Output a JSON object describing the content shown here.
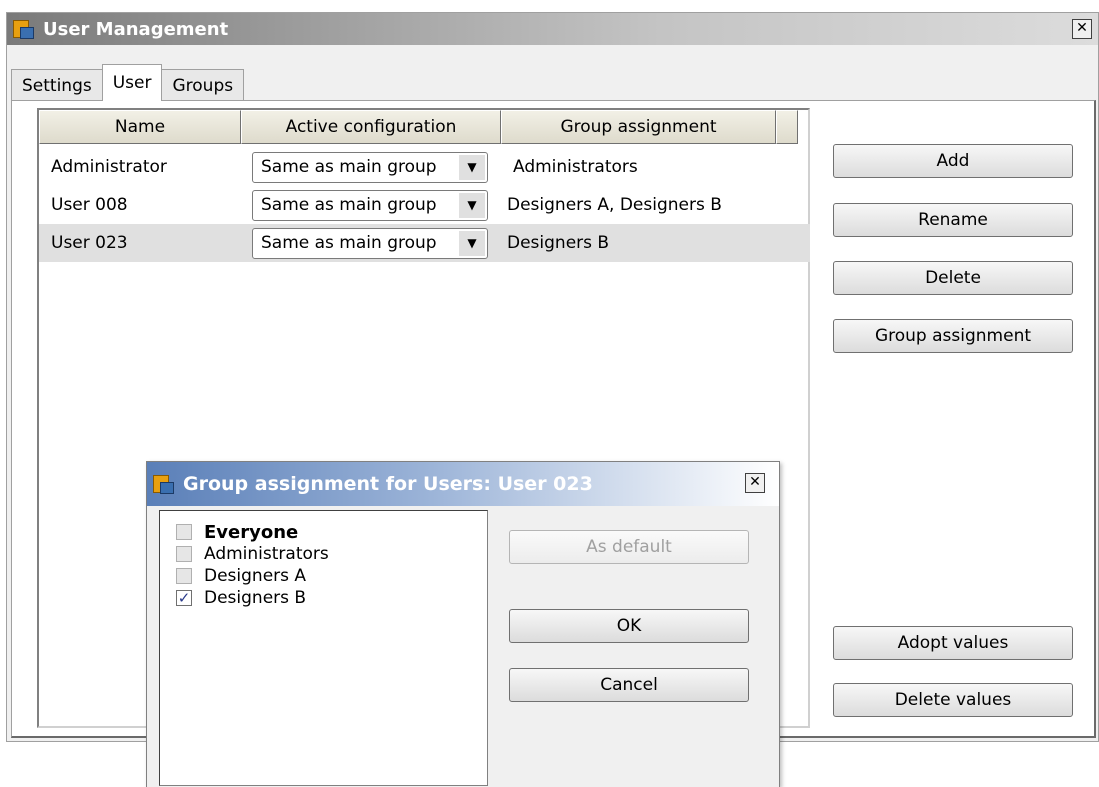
{
  "window": {
    "title": "User Management",
    "close_glyph": "✕"
  },
  "tabs": [
    {
      "label": "Settings",
      "active": false
    },
    {
      "label": "User",
      "active": true
    },
    {
      "label": "Groups",
      "active": false
    }
  ],
  "table": {
    "columns": [
      "Name",
      "Active configuration",
      "Group assignment"
    ],
    "rows": [
      {
        "name": "Administrator",
        "config": "Same as main group",
        "groups": "Administrators",
        "selected": false
      },
      {
        "name": "User 008",
        "config": "Same as main group",
        "groups": "Designers A, Designers B",
        "selected": false
      },
      {
        "name": "User 023",
        "config": "Same as main group",
        "groups": "Designers B",
        "selected": true
      }
    ]
  },
  "buttons": {
    "add": "Add",
    "rename": "Rename",
    "delete": "Delete",
    "group_assignment": "Group assignment",
    "adopt_values": "Adopt values",
    "delete_values": "Delete values"
  },
  "dialog": {
    "title": "Group assignment for Users: User 023",
    "groups": [
      {
        "label": "Everyone",
        "checked": false,
        "bold": true
      },
      {
        "label": "Administrators",
        "checked": false,
        "bold": false
      },
      {
        "label": "Designers A",
        "checked": false,
        "bold": false
      },
      {
        "label": "Designers B",
        "checked": true,
        "bold": false
      }
    ],
    "as_default": "As default",
    "ok": "OK",
    "cancel": "Cancel"
  },
  "colors": {
    "selected_row": "#e0e0e0",
    "check_mark": "#2a3a8a"
  },
  "icons": {
    "app": "user-management-app-icon",
    "dropdown": "dropdown-arrow-icon"
  }
}
